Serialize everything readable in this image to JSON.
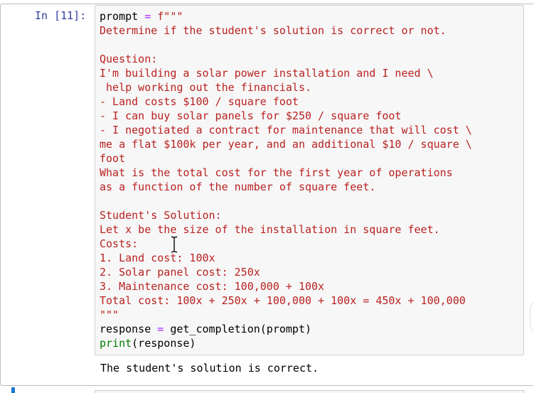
{
  "cell": {
    "prompt_label": "In [11]:",
    "code_lines": [
      [
        {
          "t": "prompt ",
          "c": ""
        },
        {
          "t": "=",
          "c": "op"
        },
        {
          "t": " f\"\"\"",
          "c": "str"
        }
      ],
      [
        {
          "t": "Determine if the student's solution is correct or not.",
          "c": "str"
        }
      ],
      [
        {
          "t": "",
          "c": ""
        }
      ],
      [
        {
          "t": "Question:",
          "c": "str"
        }
      ],
      [
        {
          "t": "I'm building a solar power installation and I need \\",
          "c": "str"
        }
      ],
      [
        {
          "t": " help working out the financials.",
          "c": "str"
        }
      ],
      [
        {
          "t": "- Land costs $100 / square foot",
          "c": "str"
        }
      ],
      [
        {
          "t": "- I can buy solar panels for $250 / square foot",
          "c": "str"
        }
      ],
      [
        {
          "t": "- I negotiated a contract for maintenance that will cost \\",
          "c": "str"
        }
      ],
      [
        {
          "t": "me a flat $100k per year, and an additional $10 / square \\",
          "c": "str"
        }
      ],
      [
        {
          "t": "foot",
          "c": "str"
        }
      ],
      [
        {
          "t": "What is the total cost for the first year of operations",
          "c": "str"
        }
      ],
      [
        {
          "t": "as a function of the number of square feet.",
          "c": "str"
        }
      ],
      [
        {
          "t": "",
          "c": ""
        }
      ],
      [
        {
          "t": "Student's Solution:",
          "c": "str"
        }
      ],
      [
        {
          "t": "Let x be the size of the installation in square feet.",
          "c": "str"
        }
      ],
      [
        {
          "t": "Costs:",
          "c": "str"
        }
      ],
      [
        {
          "t": "1. Land cost: 100x",
          "c": "str"
        }
      ],
      [
        {
          "t": "2. Solar panel cost: 250x",
          "c": "str"
        }
      ],
      [
        {
          "t": "3. Maintenance cost: 100,000 + 100x",
          "c": "str"
        }
      ],
      [
        {
          "t": "Total cost: 100x + 250x + 100,000 + 100x = 450x + 100,000",
          "c": "str"
        }
      ],
      [
        {
          "t": "\"\"\"",
          "c": "str"
        }
      ],
      [
        {
          "t": "response ",
          "c": ""
        },
        {
          "t": "=",
          "c": "op"
        },
        {
          "t": " get_completion(prompt)",
          "c": ""
        }
      ],
      [
        {
          "t": "print",
          "c": "bi"
        },
        {
          "t": "(response)",
          "c": ""
        }
      ]
    ],
    "output_text": "The student's solution is correct."
  },
  "colors": {
    "prompt_label": "#303f9f",
    "string": "#ba2121",
    "operator": "#aa22ff",
    "builtin": "#008000",
    "active_cell_marker": "#1976d2"
  },
  "icons": {
    "cursor": "text-cursor-icon"
  }
}
